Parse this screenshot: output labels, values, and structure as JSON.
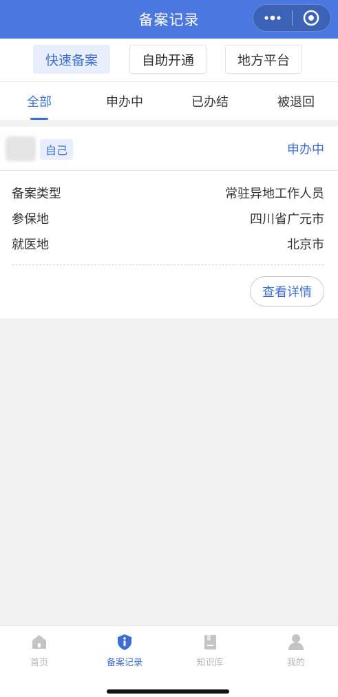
{
  "header": {
    "title": "备案记录"
  },
  "filters": [
    {
      "label": "快速备案",
      "active": true
    },
    {
      "label": "自助开通",
      "active": false
    },
    {
      "label": "地方平台",
      "active": false
    }
  ],
  "tabs": [
    {
      "label": "全部",
      "active": true
    },
    {
      "label": "申办中",
      "active": false
    },
    {
      "label": "已办结",
      "active": false
    },
    {
      "label": "被退回",
      "active": false
    }
  ],
  "record": {
    "tag": "自己",
    "status": "申办中",
    "rows": [
      {
        "label": "备案类型",
        "value": "常驻异地工作人员"
      },
      {
        "label": "参保地",
        "value": "四川省广元市"
      },
      {
        "label": "就医地",
        "value": "北京市"
      }
    ],
    "detail_button": "查看详情"
  },
  "bottom_nav": [
    {
      "label": "首页",
      "icon": "home-icon",
      "active": false
    },
    {
      "label": "备案记录",
      "icon": "shield-info-icon",
      "active": true
    },
    {
      "label": "知识库",
      "icon": "book-icon",
      "active": false
    },
    {
      "label": "我的",
      "icon": "user-icon",
      "active": false
    }
  ],
  "colors": {
    "brand": "#4a78e0",
    "accent": "#3f6ed2",
    "inactive": "#b5b5b5"
  }
}
